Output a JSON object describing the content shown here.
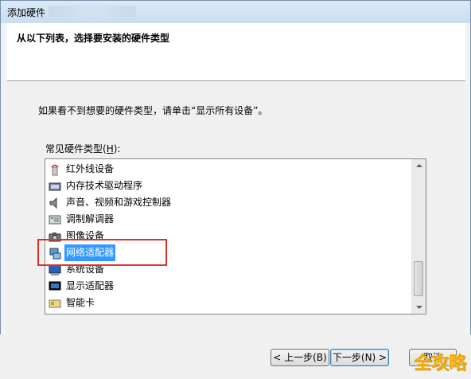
{
  "window": {
    "title": "添加硬件"
  },
  "header": {
    "text": "从以下列表，选择要安装的硬件类型"
  },
  "main": {
    "instruction": "如果看不到想要的硬件类型，请单击“显示所有设备”。",
    "list_label_prefix": "常见硬件类型(",
    "list_label_mnemonic": "H",
    "list_label_suffix": "):",
    "items": [
      {
        "label": "红外线设备",
        "icon": "infrared-icon"
      },
      {
        "label": "内存技术驱动程序",
        "icon": "memory-driver-icon"
      },
      {
        "label": "声音、视频和游戏控制器",
        "icon": "speaker-icon"
      },
      {
        "label": "调制解调器",
        "icon": "modem-icon"
      },
      {
        "label": "图像设备",
        "icon": "camera-icon"
      },
      {
        "label": "网络适配器",
        "icon": "network-adapter-icon",
        "selected": true
      },
      {
        "label": "系统设备",
        "icon": "system-device-icon"
      },
      {
        "label": "显示适配器",
        "icon": "display-adapter-icon"
      },
      {
        "label": "智能卡",
        "icon": "smart-card-icon"
      }
    ]
  },
  "buttons": {
    "back": "< 上一步(B)",
    "next": "下一步(N) >",
    "cancel": "取消"
  },
  "watermark": "全攻略",
  "colors": {
    "selection": "#3399ff",
    "highlight_box": "#e0302a"
  }
}
